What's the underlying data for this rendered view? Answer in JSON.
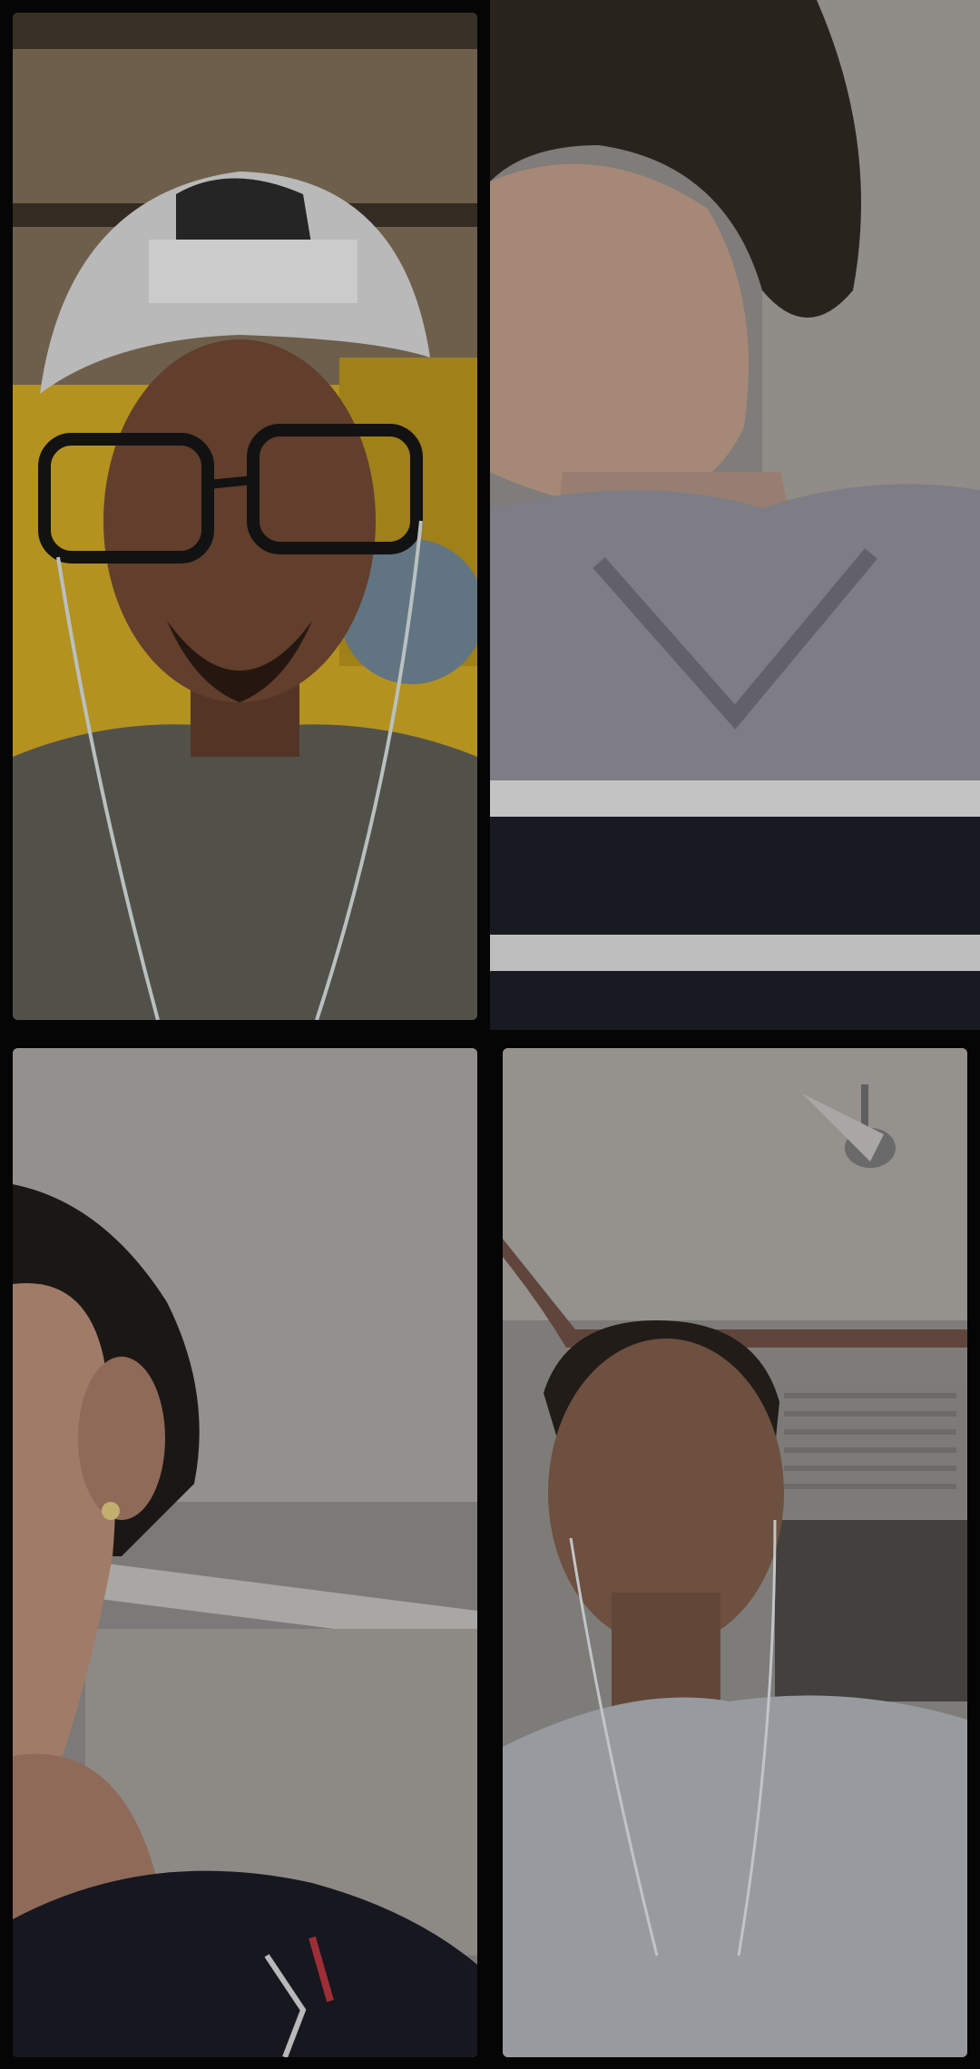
{
  "call": {
    "layout": "grid-2x2",
    "participants": [
      {
        "id": "p1",
        "video_on": true
      },
      {
        "id": "p2",
        "video_on": true
      },
      {
        "id": "p3",
        "video_on": true
      },
      {
        "id": "p4",
        "video_on": true
      }
    ]
  },
  "colors": {
    "background": "#050505",
    "tile_border": "#111111"
  }
}
